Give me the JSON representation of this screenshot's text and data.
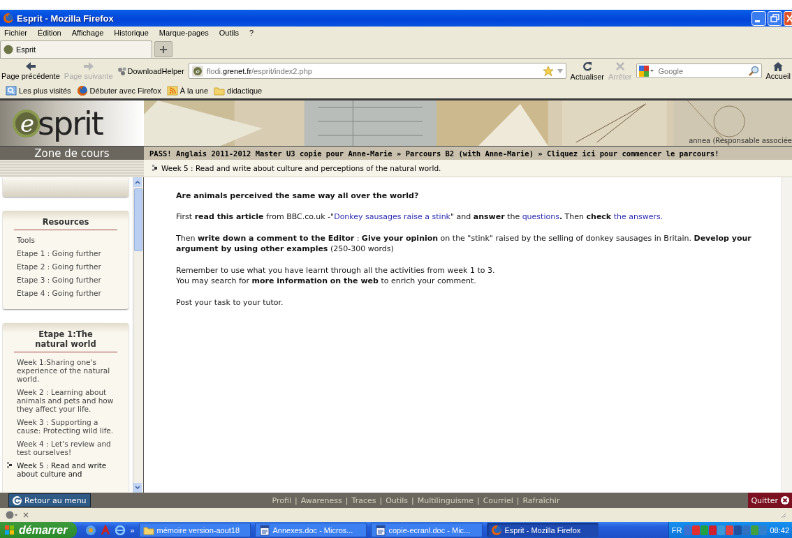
{
  "window": {
    "title": "Esprit - Mozilla Firefox"
  },
  "menu": [
    "Fichier",
    "Édition",
    "Affichage",
    "Historique",
    "Marque-pages",
    "Outils",
    "?"
  ],
  "tabs": [
    {
      "label": "Esprit",
      "selected": true
    }
  ],
  "nav_left": [
    {
      "label": "Page précédente",
      "kind": "back",
      "disabled": false
    },
    {
      "label": "Page suivante",
      "kind": "forward",
      "disabled": true
    },
    {
      "label": "DownloadHelper",
      "kind": "download",
      "disabled": false
    }
  ],
  "address": {
    "prefix": "flodi.",
    "domain": "grenet.fr",
    "path": "/esprit/index2.php"
  },
  "nav_right": [
    {
      "label": "Actualiser",
      "kind": "reload",
      "disabled": false
    },
    {
      "label": "Arrêter",
      "kind": "stop",
      "disabled": true
    }
  ],
  "search": {
    "placeholder": "Google"
  },
  "home": {
    "label": "Accueil"
  },
  "bookmarks": [
    {
      "label": "Les plus visités",
      "kind": "smart"
    },
    {
      "label": "Débuter avec Firefox",
      "kind": "firefox"
    },
    {
      "label": "À la une",
      "kind": "feed"
    },
    {
      "label": "didactique",
      "kind": "folder"
    }
  ],
  "site": {
    "logo": {
      "mark": "e",
      "text": "sprit"
    },
    "user": "annea (Responsable associée",
    "zone": "Zone de cours",
    "breadcrumb": "PASS! Anglais 2011-2012 Master U3 copie pour Anne-Marie » Parcours B2 (with Anne-Marie) » Cliquez ici pour commencer le parcours!",
    "current_week": "Week 5 : Read and write about culture and perceptions of the natural world."
  },
  "sidebar": {
    "sections": [
      {
        "title": "Resources",
        "items": [
          {
            "label": "Tools",
            "selected": false
          },
          {
            "label": "Etape 1 : Going further",
            "selected": false
          },
          {
            "label": "Etape 2 : Going further",
            "selected": false
          },
          {
            "label": "Etape 3 : Going further",
            "selected": false
          },
          {
            "label": "Etape 4 : Going further",
            "selected": false
          }
        ]
      },
      {
        "title": "Etape 1:The natural world",
        "items": [
          {
            "label": "Week 1:Sharing one's experience of the natural world.",
            "selected": false
          },
          {
            "label": "Week 2 : Learning about animals and pets and how they affect your life.",
            "selected": false
          },
          {
            "label": "Week 3 : Supporting a cause: Protecting wild life.",
            "selected": false
          },
          {
            "label": "Week 4 : Let's review and test ourselves!",
            "selected": false
          },
          {
            "label": "Week 5 : Read and write about culture and",
            "selected": true
          }
        ]
      }
    ]
  },
  "content": {
    "question": "Are animals perceived the same way all over the world?",
    "paragraphs": [
      {
        "lines": [
          [
            {
              "kind": "text",
              "text": "First **read this article** from BBC.co.uk -\""
            },
            {
              "kind": "link",
              "text": "Donkey sausages raise a stink"
            },
            {
              "kind": "text",
              "text": "\" and **answer** the "
            },
            {
              "kind": "link",
              "text": "questions"
            },
            {
              "kind": "text",
              "text": "**.** Then **check** "
            },
            {
              "kind": "link",
              "text": "the answers."
            }
          ]
        ]
      },
      {
        "lines": [
          [
            {
              "kind": "text",
              "text": "Then **write down a comment to the Editor** : **Give your opinion** on the \"stink\" raised by the selling of donkey sausages in Britain. **Develop your argument by using other examples** (250-300 words)"
            }
          ]
        ]
      },
      {
        "lines": [
          [
            {
              "kind": "text",
              "text": "Remember to use what you have learnt through all the activities from week 1 to 3."
            }
          ],
          [
            {
              "kind": "text",
              "text": "You may search for **more information on the web** to enrich your comment."
            }
          ]
        ]
      },
      {
        "lines": [
          [
            {
              "kind": "text",
              "text": "Post your task to your tutor."
            }
          ]
        ]
      }
    ]
  },
  "footer": {
    "back": "Retour au menu",
    "links": [
      "Profil",
      "Awareness",
      "Traces",
      "Outils",
      "Multilinguisme",
      "Courriel",
      "Rafraîchir"
    ],
    "separator": "|",
    "quit": "Quitter"
  },
  "addon_bar": {
    "close": "×"
  },
  "taskbar": {
    "start": "démarrer",
    "more": "»",
    "tasks": [
      {
        "label": "mémoire version-aout18",
        "kind": "folder",
        "selected": false
      },
      {
        "label": "Annexes.doc - Micros...",
        "kind": "word",
        "selected": false
      },
      {
        "label": "copie-ecranl.doc - Mic...",
        "kind": "word",
        "selected": false
      },
      {
        "label": "Esprit - Mozilla Firefox",
        "kind": "firefox",
        "selected": true
      }
    ],
    "language": "FR",
    "clock": "08:42"
  }
}
